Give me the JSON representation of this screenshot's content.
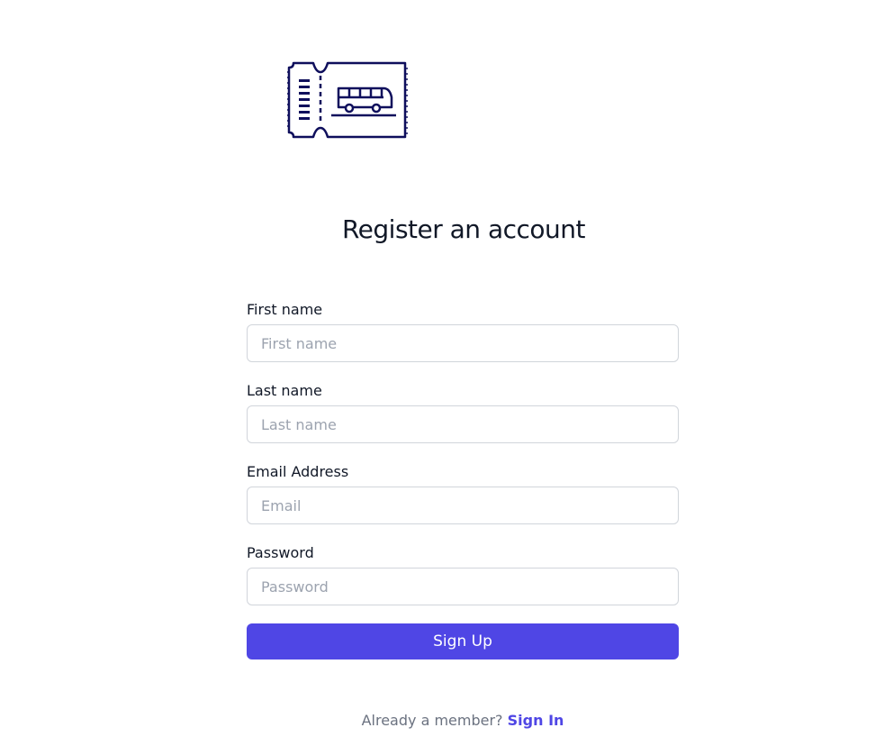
{
  "brand": {
    "logo_icon": "bus-ticket-icon",
    "logo_color": "#0f0f5c"
  },
  "heading": "Register an account",
  "form": {
    "first_name": {
      "label": "First name",
      "placeholder": "First name"
    },
    "last_name": {
      "label": "Last name",
      "placeholder": "Last name"
    },
    "email": {
      "label": "Email Address",
      "placeholder": "Email"
    },
    "password": {
      "label": "Password",
      "placeholder": "Password"
    },
    "submit_label": "Sign Up"
  },
  "footer": {
    "prompt": "Already a member?",
    "link_label": "Sign In"
  },
  "colors": {
    "accent": "#4f46e5",
    "text": "#111827",
    "muted": "#6b7280",
    "border": "#d1d5db"
  }
}
